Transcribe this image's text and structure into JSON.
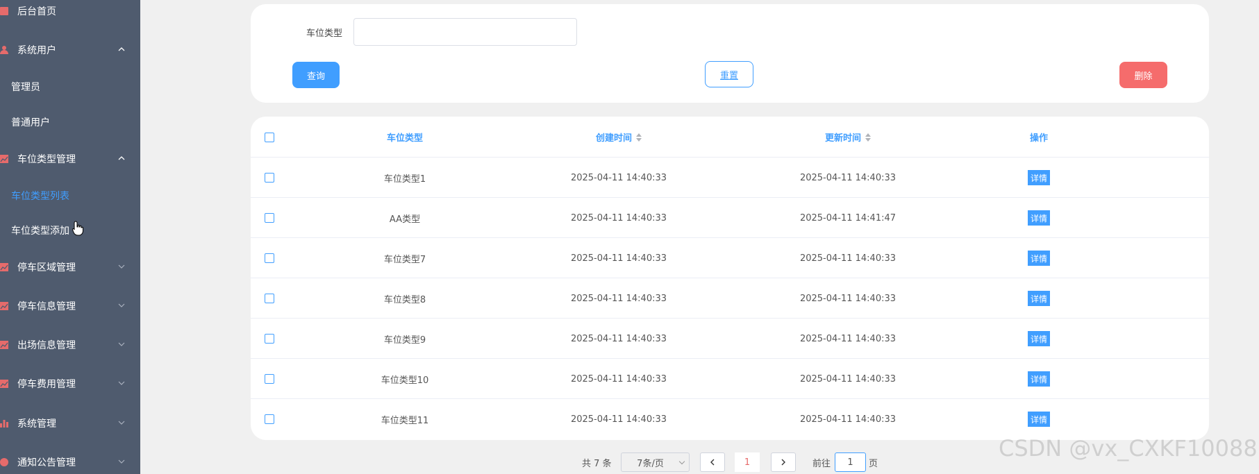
{
  "sidebar": {
    "items": [
      {
        "label": "后台首页",
        "icon": "monitor-icon"
      },
      {
        "label": "系统用户",
        "icon": "user-icon",
        "expanded": true,
        "children": [
          {
            "label": "管理员"
          },
          {
            "label": "普通用户"
          }
        ]
      },
      {
        "label": "车位类型管理",
        "icon": "chart-icon",
        "expanded": true,
        "children": [
          {
            "label": "车位类型列表",
            "active": true
          },
          {
            "label": "车位类型添加"
          }
        ]
      },
      {
        "label": "停车区域管理",
        "icon": "chart-icon"
      },
      {
        "label": "停车信息管理",
        "icon": "chart-icon"
      },
      {
        "label": "出场信息管理",
        "icon": "chart-icon"
      },
      {
        "label": "停车费用管理",
        "icon": "chart-icon"
      },
      {
        "label": "系统管理",
        "icon": "bar-chart-icon"
      },
      {
        "label": "通知公告管理",
        "icon": "info-icon"
      }
    ]
  },
  "search": {
    "label": "车位类型",
    "value": "",
    "query_label": "查询",
    "reset_label": "重置",
    "delete_label": "删除"
  },
  "table": {
    "headers": {
      "type": "车位类型",
      "created": "创建时间",
      "updated": "更新时间",
      "op": "操作"
    },
    "rows": [
      {
        "type": "车位类型1",
        "created": "2025-04-11 14:40:33",
        "updated": "2025-04-11 14:40:33",
        "action": "详情"
      },
      {
        "type": "AA类型",
        "created": "2025-04-11 14:40:33",
        "updated": "2025-04-11 14:41:47",
        "action": "详情"
      },
      {
        "type": "车位类型7",
        "created": "2025-04-11 14:40:33",
        "updated": "2025-04-11 14:40:33",
        "action": "详情"
      },
      {
        "type": "车位类型8",
        "created": "2025-04-11 14:40:33",
        "updated": "2025-04-11 14:40:33",
        "action": "详情"
      },
      {
        "type": "车位类型9",
        "created": "2025-04-11 14:40:33",
        "updated": "2025-04-11 14:40:33",
        "action": "详情"
      },
      {
        "type": "车位类型10",
        "created": "2025-04-11 14:40:33",
        "updated": "2025-04-11 14:40:33",
        "action": "详情"
      },
      {
        "type": "车位类型11",
        "created": "2025-04-11 14:40:33",
        "updated": "2025-04-11 14:40:33",
        "action": "详情"
      }
    ]
  },
  "pagination": {
    "total": "共 7 条",
    "page_size": "7条/页",
    "current_page": "1",
    "goto_label": "前往",
    "goto_value": "1",
    "page_suffix": "页"
  },
  "watermark": "CSDN @vx_CXKF10088",
  "colors": {
    "sidebar_bg": "#4f5b6e",
    "accent": "#409eff",
    "danger": "#f56c6c",
    "icon_red": "#e66b6b"
  }
}
